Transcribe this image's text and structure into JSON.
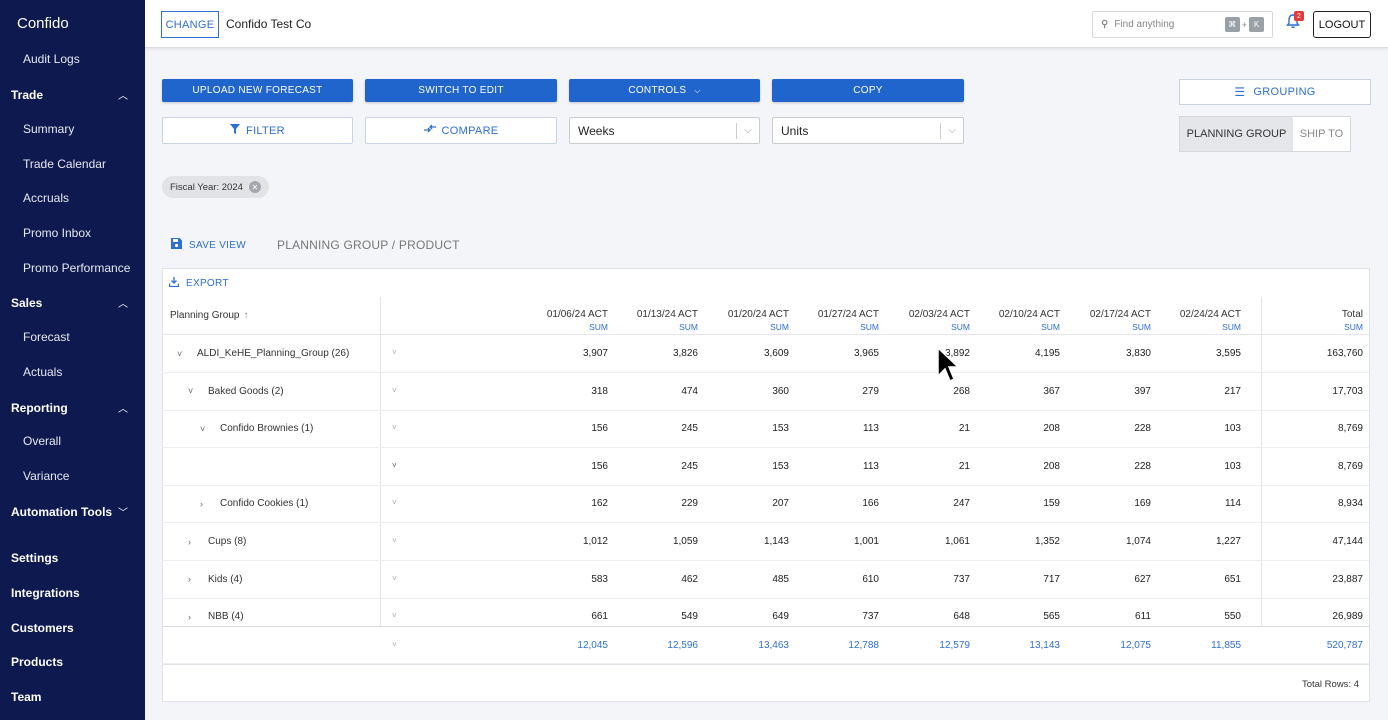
{
  "sidebar": {
    "brand": "Confido",
    "audit_logs": "Audit Logs",
    "trade": {
      "label": "Trade",
      "items": [
        "Summary",
        "Trade Calendar",
        "Accruals",
        "Promo Inbox",
        "Promo Performance"
      ]
    },
    "sales": {
      "label": "Sales",
      "items": [
        "Forecast",
        "Actuals"
      ]
    },
    "reporting": {
      "label": "Reporting",
      "items": [
        "Overall",
        "Variance"
      ]
    },
    "automation": "Automation Tools",
    "settings": "Settings",
    "integrations": "Integrations",
    "customers": "Customers",
    "products": "Products",
    "team": "Team"
  },
  "topbar": {
    "change_label": "CHANGE",
    "company": "Confido Test Co",
    "search_placeholder": "Find anything",
    "key_cmd": "⌘",
    "key_plus": "+",
    "key_k": "K",
    "notif_count": "2",
    "logout_label": "LOGOUT"
  },
  "toolbar": {
    "upload": "UPLOAD NEW FORECAST",
    "switch_edit": "SWITCH TO EDIT",
    "controls": "CONTROLS",
    "copy": "COPY",
    "filter": "FILTER",
    "compare": "COMPARE",
    "period_select": "Weeks",
    "measure_select": "Units",
    "grouping": "GROUPING",
    "toggle_planning_group": "PLANNING GROUP",
    "toggle_ship_to": "SHIP TO"
  },
  "filter_chip": "Fiscal Year: 2024",
  "view": {
    "save_view": "SAVE VIEW",
    "breadcrumb": "PLANNING GROUP / PRODUCT",
    "export": "EXPORT"
  },
  "grid": {
    "first_col_header": "Planning Group",
    "agg_label": "SUM",
    "columns": [
      "01/06/24 ACT",
      "01/13/24 ACT",
      "01/20/24 ACT",
      "01/27/24 ACT",
      "02/03/24 ACT",
      "02/10/24 ACT",
      "02/17/24 ACT",
      "02/24/24 ACT"
    ],
    "total_header": "Total",
    "rows": [
      {
        "label": "ALDI_KeHE_Planning_Group (26)",
        "values": [
          "3,907",
          "3,826",
          "3,609",
          "3,965",
          "3,892",
          "4,195",
          "3,830",
          "3,595"
        ],
        "total": "163,760"
      },
      {
        "label": "Baked Goods (2)",
        "values": [
          "318",
          "474",
          "360",
          "279",
          "268",
          "367",
          "397",
          "217"
        ],
        "total": "17,703"
      },
      {
        "label": "Confido Brownies (1)",
        "values": [
          "156",
          "245",
          "153",
          "113",
          "21",
          "208",
          "228",
          "103"
        ],
        "total": "8,769"
      },
      {
        "label": "",
        "values": [
          "156",
          "245",
          "153",
          "113",
          "21",
          "208",
          "228",
          "103"
        ],
        "total": "8,769"
      },
      {
        "label": "Confido Cookies (1)",
        "values": [
          "162",
          "229",
          "207",
          "166",
          "247",
          "159",
          "169",
          "114"
        ],
        "total": "8,934"
      },
      {
        "label": "Cups (8)",
        "values": [
          "1,012",
          "1,059",
          "1,143",
          "1,001",
          "1,061",
          "1,352",
          "1,074",
          "1,227"
        ],
        "total": "47,144"
      },
      {
        "label": "Kids (4)",
        "values": [
          "583",
          "462",
          "485",
          "610",
          "737",
          "717",
          "627",
          "651"
        ],
        "total": "23,887"
      },
      {
        "label": "NBB (4)",
        "values": [
          "661",
          "549",
          "649",
          "737",
          "648",
          "565",
          "611",
          "550"
        ],
        "total": "26,989"
      }
    ],
    "totals": {
      "values": [
        "12,045",
        "12,596",
        "13,463",
        "12,788",
        "12,579",
        "13,143",
        "12,075",
        "11,855"
      ],
      "total": "520,787"
    },
    "total_rows": "Total Rows: 4"
  },
  "colors": {
    "sidebar_bg": "#0e1a4f",
    "primary": "#2065cc",
    "link": "#2f6fd1"
  }
}
